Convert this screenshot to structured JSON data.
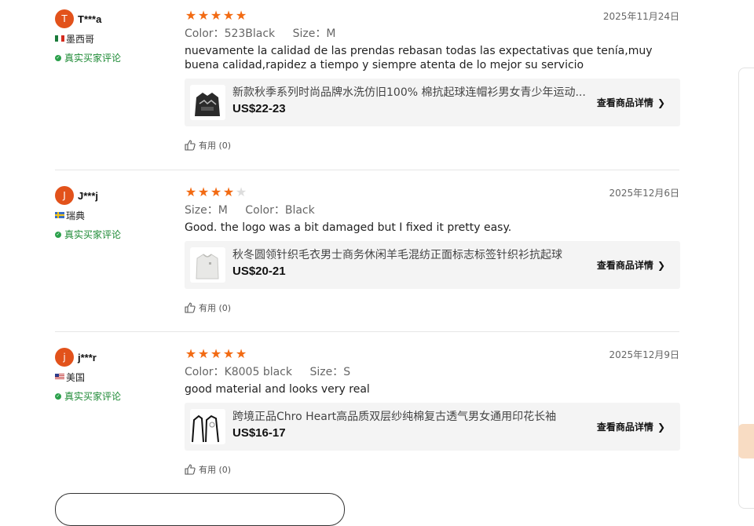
{
  "reviews": [
    {
      "avatar_letter": "T",
      "username": "T***a",
      "country": "墨西哥",
      "verified": "真实买家评论",
      "stars": 5,
      "date": "2025年11月24日",
      "attrs": [
        {
          "label": "Color：",
          "value": "523Black"
        },
        {
          "label": "Size：",
          "value": "M"
        }
      ],
      "content": "nuevamente la calidad de las prendas rebasan todas las expectativas que tenía,muy buena calidad,rapidez a tiempo y siempre atenta de lo mejor su servicio",
      "product": {
        "title": "新款秋季系列时尚品牌水洗仿旧100% 棉抗起球连帽衫男女青少年运动...",
        "price": "US$22-23",
        "detail_label": "查看商品详情"
      },
      "helpful": "有用 (0)"
    },
    {
      "avatar_letter": "J",
      "username": "J***j",
      "country": "瑞典",
      "verified": "真实买家评论",
      "stars": 4,
      "date": "2025年12月6日",
      "attrs": [
        {
          "label": "Size：",
          "value": "M"
        },
        {
          "label": "Color：",
          "value": "Black"
        }
      ],
      "content": "Good. the logo was a bit damaged but I fixed it pretty easy.",
      "product": {
        "title": "秋冬圆领针织毛衣男士商务休闲羊毛混纺正面标志标签针织衫抗起球",
        "price": "US$20-21",
        "detail_label": "查看商品详情"
      },
      "helpful": "有用 (0)"
    },
    {
      "avatar_letter": "j",
      "username": "j***r",
      "country": "美国",
      "verified": "真实买家评论",
      "stars": 5,
      "date": "2025年12月9日",
      "attrs": [
        {
          "label": "Color：",
          "value": "K8005 black"
        },
        {
          "label": "Size：",
          "value": "S"
        }
      ],
      "content": "good material and looks very real",
      "product": {
        "title": "跨境正品Chro Heart高品质双层纱纯棉复古透气男女通用印花长袖",
        "price": "US$16-17",
        "detail_label": "查看商品详情"
      },
      "helpful": "有用 (0)"
    }
  ],
  "colors": {
    "star": "#f26a12",
    "avatar": "#e2521b",
    "verified": "#1d8a35"
  }
}
